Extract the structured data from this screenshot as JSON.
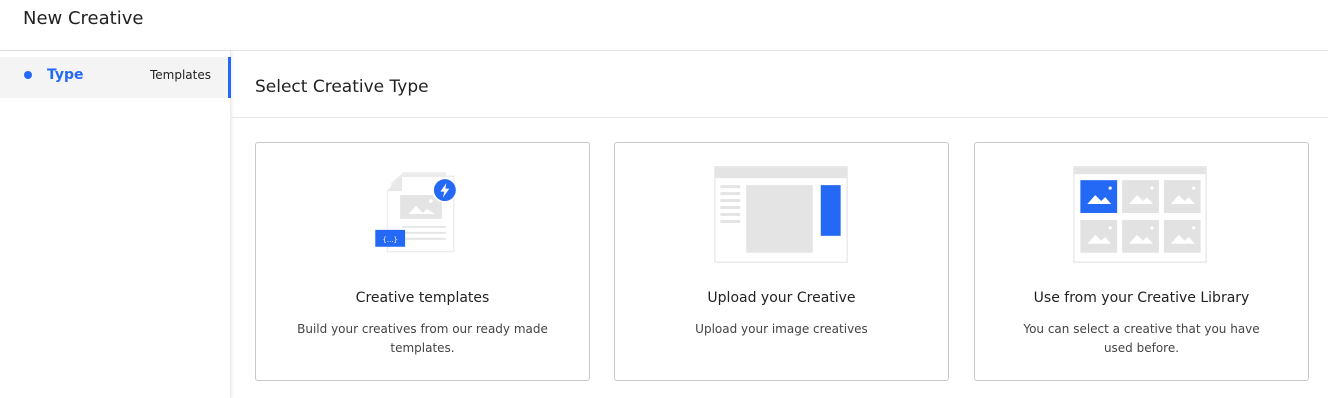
{
  "header": {
    "title": "New Creative"
  },
  "sidebar": {
    "steps": [
      {
        "label": "Type",
        "sub": "Templates"
      }
    ]
  },
  "main": {
    "section_title": "Select Creative Type",
    "cards": [
      {
        "icon": "template-doc-icon",
        "title": "Creative templates",
        "description": "Build your creatives from our ready made templates."
      },
      {
        "icon": "upload-layout-icon",
        "title": "Upload your Creative",
        "description": "Upload your image creatives"
      },
      {
        "icon": "image-library-icon",
        "title": "Use from your Creative Library",
        "description": "You can select a creative that you have used before."
      }
    ]
  },
  "colors": {
    "accent": "#2469f5",
    "placeholder_gray": "#e2e2e2",
    "border": "#c8c8c8"
  }
}
